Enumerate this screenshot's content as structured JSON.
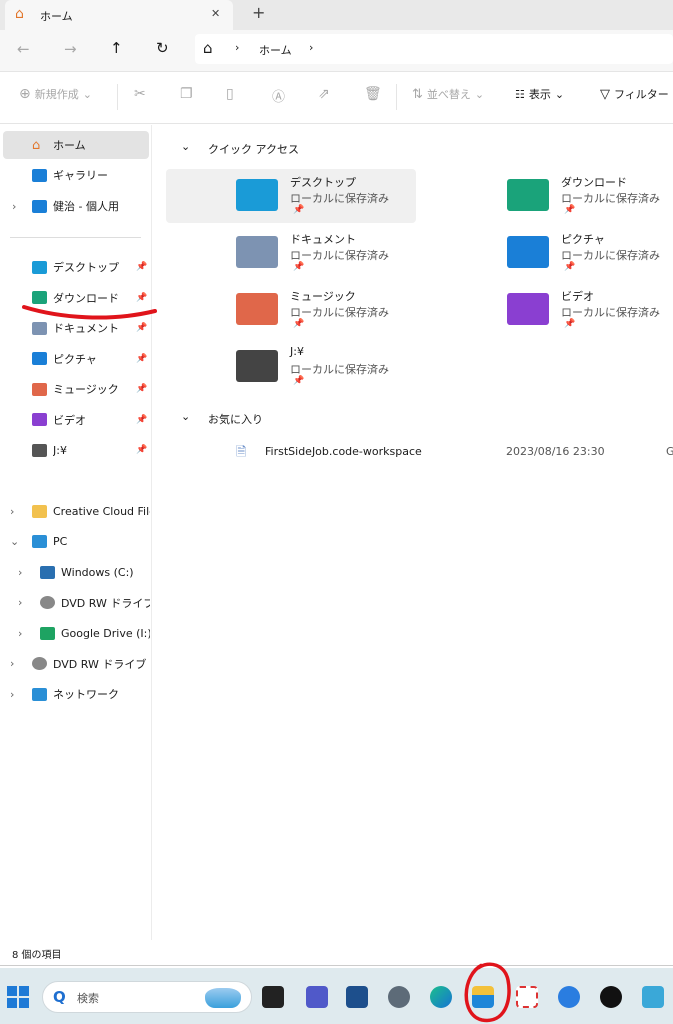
{
  "tab": {
    "title": "ホーム",
    "close": "✕",
    "new": "+"
  },
  "nav": {
    "back": "←",
    "forward": "→",
    "up": "↑",
    "refresh": "↻",
    "breadcrumb": [
      "ホーム"
    ],
    "sep": "›"
  },
  "toolbar": {
    "new": "新規作成",
    "sort": "並べ替え",
    "view": "表示",
    "filter": "フィルター"
  },
  "sidebar": {
    "top": [
      {
        "label": "ホーム",
        "icon": "home-icon",
        "selected": true
      },
      {
        "label": "ギャラリー",
        "icon": "gallery-icon"
      },
      {
        "label": "健治 - 個人用",
        "icon": "onedrive-icon",
        "expand": true
      }
    ],
    "pinned": [
      {
        "label": "デスクトップ",
        "icon": "desktop-icon",
        "color": "#1a9bd7"
      },
      {
        "label": "ダウンロード",
        "icon": "download-icon",
        "color": "#1aa37a"
      },
      {
        "label": "ドキュメント",
        "icon": "documents-icon",
        "color": "#7d93b2"
      },
      {
        "label": "ピクチャ",
        "icon": "pictures-icon",
        "color": "#1a7fd7"
      },
      {
        "label": "ミュージック",
        "icon": "music-icon",
        "color": "#e0674a"
      },
      {
        "label": "ビデオ",
        "icon": "videos-icon",
        "color": "#8a3fd1"
      },
      {
        "label": "J:¥",
        "icon": "drive-icon",
        "color": "#555555"
      }
    ],
    "tree": [
      {
        "label": "Creative Cloud Files",
        "icon": "folder-icon",
        "level": 0,
        "chev": "›"
      },
      {
        "label": "PC",
        "icon": "pc-icon",
        "level": 0,
        "chev": "⌄"
      },
      {
        "label": "Windows (C:)",
        "icon": "windows-drive-icon",
        "level": 1,
        "chev": "›"
      },
      {
        "label": "DVD RW ドライブ (C",
        "icon": "dvd-icon",
        "level": 1,
        "chev": "›"
      },
      {
        "label": "Google Drive (I:)",
        "icon": "google-drive-icon",
        "level": 1,
        "chev": "›"
      },
      {
        "label": "DVD RW ドライブ (G:)",
        "icon": "dvd-icon",
        "level": 0,
        "chev": "›"
      },
      {
        "label": "ネットワーク",
        "icon": "network-icon",
        "level": 0,
        "chev": "›"
      }
    ]
  },
  "main": {
    "quick_access": "クイック アクセス",
    "favorites": "お気に入り",
    "local": "ローカルに保存済み",
    "items": [
      {
        "name": "デスクトップ",
        "color": "#1a9bd7"
      },
      {
        "name": "ダウンロード",
        "color": "#1aa37a"
      },
      {
        "name": "ドキュメント",
        "color": "#7d93b2"
      },
      {
        "name": "ピクチャ",
        "color": "#1a7fd7"
      },
      {
        "name": "ミュージック",
        "color": "#e0674a"
      },
      {
        "name": "ビデオ",
        "color": "#8a3fd1"
      },
      {
        "name": "J:¥",
        "color": "#444444"
      }
    ],
    "fav_file": {
      "name": "FirstSideJob.code-workspace",
      "date": "2023/08/16 23:30",
      "extra": "G"
    }
  },
  "status": "8 個の項目",
  "taskbar": {
    "search": "検索"
  },
  "annotation_color": "#e0141b"
}
